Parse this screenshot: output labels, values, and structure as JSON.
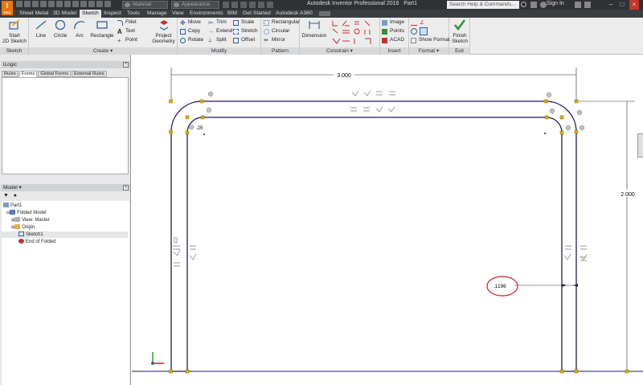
{
  "app": {
    "logo_text": "I",
    "logo_sub": "PRO",
    "title": "Autodesk Inventor Professional 2016",
    "document": "Part1",
    "material_placeholder": "Material",
    "appearance_placeholder": "Appearance",
    "search_placeholder": "Search Help & Commands...",
    "signin": "Sign In"
  },
  "tabs": [
    {
      "label": "Sheet Metal",
      "active": false
    },
    {
      "label": "3D Model",
      "active": false
    },
    {
      "label": "Sketch",
      "active": true
    },
    {
      "label": "Inspect",
      "active": false
    },
    {
      "label": "Tools",
      "active": false
    },
    {
      "label": "Manage",
      "active": false
    },
    {
      "label": "View",
      "active": false
    },
    {
      "label": "Environments",
      "active": false
    },
    {
      "label": "BIM",
      "active": false
    },
    {
      "label": "Get Started",
      "active": false
    },
    {
      "label": "Autodesk A360",
      "active": false
    }
  ],
  "ribbon": {
    "sketch": {
      "title": "Sketch",
      "start": "Start",
      "start2": "2D Sketch"
    },
    "create": {
      "title": "Create",
      "line": "Line",
      "circle": "Circle",
      "arc": "Arc",
      "rectangle": "Rectangle",
      "fillet": "Fillet",
      "text": "Text",
      "point": "Point",
      "project": "Project",
      "project2": "Geometry"
    },
    "modify": {
      "title": "Modify",
      "move": "Move",
      "copy": "Copy",
      "rotate": "Rotate",
      "trim": "Trim",
      "extend": "Extend",
      "split": "Split",
      "scale": "Scale",
      "stretch": "Stretch",
      "offset": "Offset"
    },
    "pattern": {
      "title": "Pattern",
      "rectangular": "Rectangular",
      "circular": "Circular",
      "mirror": "Mirror"
    },
    "constrain": {
      "title": "Constrain",
      "dimension": "Dimension"
    },
    "insert": {
      "title": "Insert",
      "image": "Image",
      "points": "Points",
      "acad": "ACAD"
    },
    "format": {
      "title": "Format",
      "show_format": "Show Format"
    },
    "exit": {
      "title": "Exit",
      "finish": "Finish",
      "finish2": "Sketch"
    }
  },
  "ilogic": {
    "title": "iLogic",
    "tabs": [
      {
        "label": "Rules",
        "active": false
      },
      {
        "label": "Forms",
        "active": true
      },
      {
        "label": "Global Forms",
        "active": false
      },
      {
        "label": "External Rules",
        "active": false
      }
    ]
  },
  "model": {
    "title": "Model",
    "tree": [
      {
        "label": "Part1",
        "indent": 0
      },
      {
        "label": "Folded Model",
        "indent": 1
      },
      {
        "label": "View: Master",
        "indent": 2
      },
      {
        "label": "Origin",
        "indent": 2
      },
      {
        "label": "Sketch1",
        "indent": 2
      },
      {
        "label": "End of Folded",
        "indent": 2
      }
    ]
  },
  "sketch": {
    "dim_width": "3.000",
    "dim_height": "2.000",
    "dim_radius": ".25",
    "dim_thickness": ".1196",
    "circle_color": "#d0201a",
    "line_color": "#1a1f5c",
    "point_color": "#e0b000"
  }
}
